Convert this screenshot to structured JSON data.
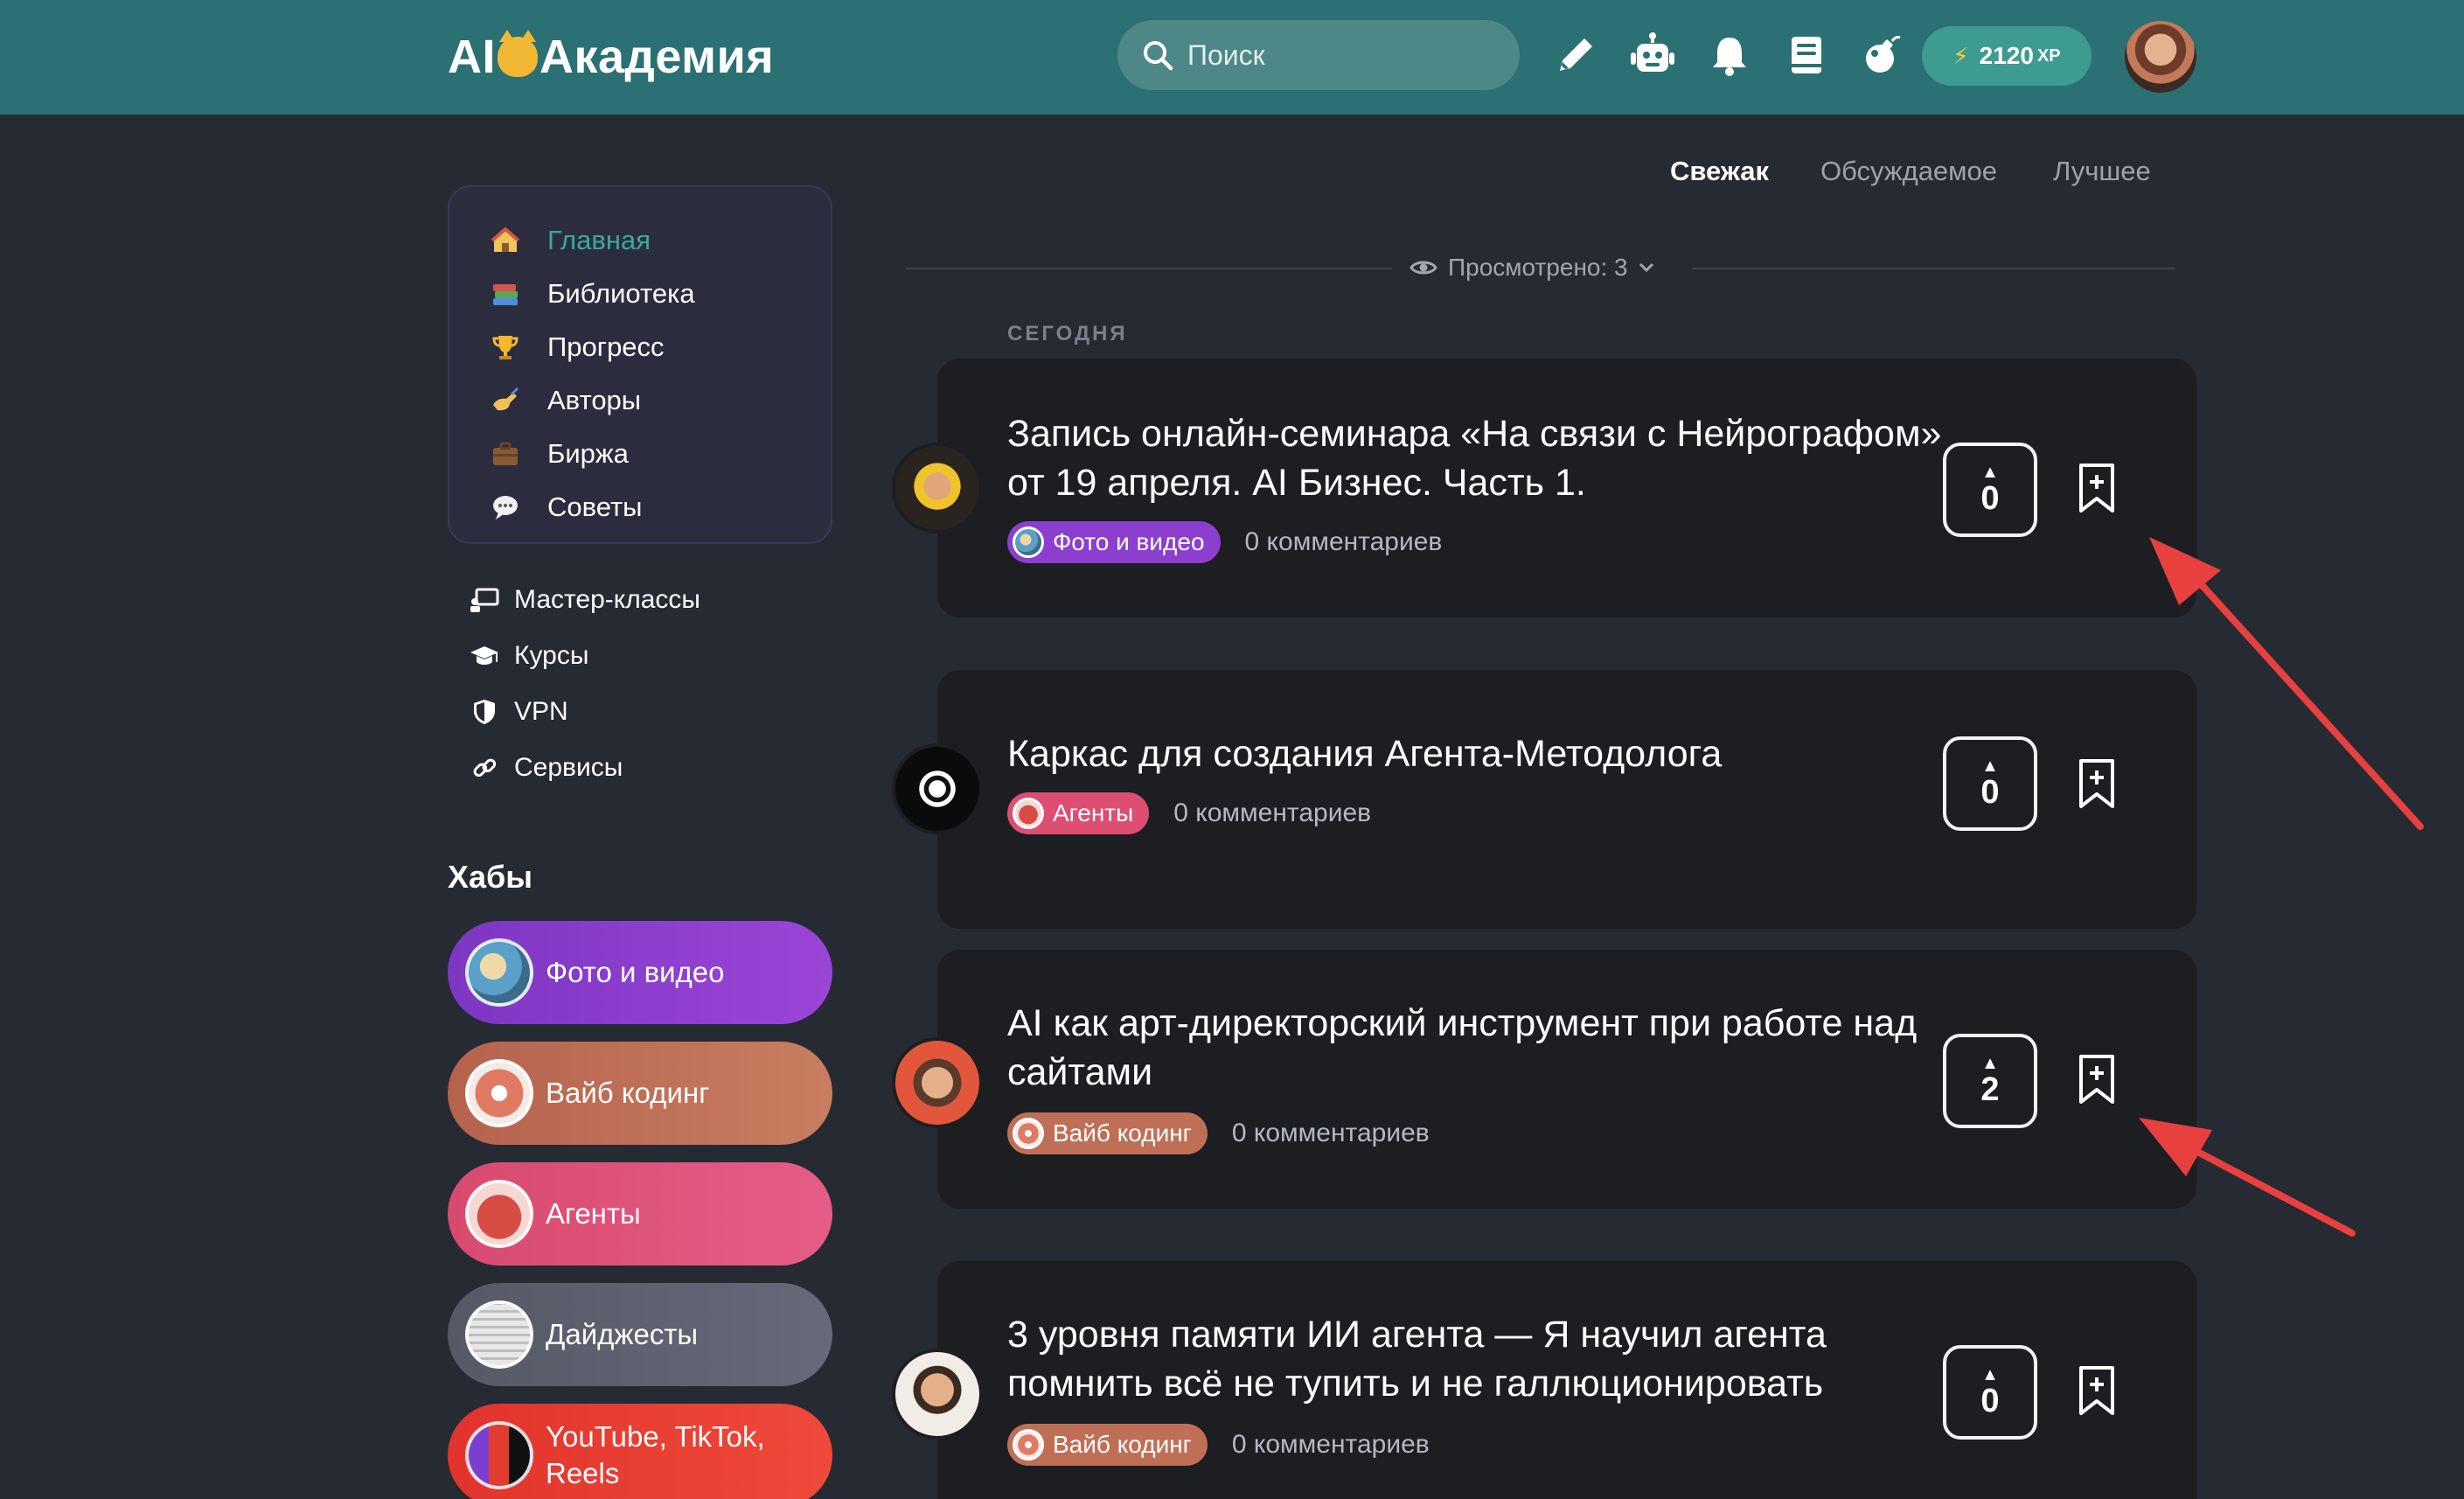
{
  "header": {
    "logo": {
      "prefix": "AI",
      "suffix": "Академия"
    },
    "search_placeholder": "Поиск",
    "xp_value": "2120",
    "xp_label": "XP",
    "icons": [
      "pencil-icon",
      "robot-icon",
      "bell-icon",
      "book-icon",
      "bomb-icon"
    ]
  },
  "sidebar": {
    "nav": [
      {
        "label": "Главная",
        "icon": "house-icon",
        "active": true
      },
      {
        "label": "Библиотека",
        "icon": "books-icon"
      },
      {
        "label": "Прогресс",
        "icon": "trophy-icon"
      },
      {
        "label": "Авторы",
        "icon": "writing-hand-icon"
      },
      {
        "label": "Биржа",
        "icon": "briefcase-icon"
      },
      {
        "label": "Советы",
        "icon": "speech-bubble-icon"
      }
    ],
    "links": [
      {
        "label": "Мастер-классы",
        "icon": "presentation-icon"
      },
      {
        "label": "Курсы",
        "icon": "graduation-cap-icon"
      },
      {
        "label": "VPN",
        "icon": "shield-icon"
      },
      {
        "label": "Сервисы",
        "icon": "link-icon"
      }
    ],
    "hubs_title": "Хабы",
    "hubs": [
      {
        "label": "Фото и видео",
        "color": "#8e3ed0"
      },
      {
        "label": "Вайб кодинг",
        "color": "#bb6d55"
      },
      {
        "label": "Агенты",
        "color": "#dd5178"
      },
      {
        "label": "Дайджесты",
        "color": "#5b5e6b"
      },
      {
        "label": "YouTube, TikTok, Reels",
        "color": "#e6392f"
      }
    ]
  },
  "feed": {
    "tabs": [
      {
        "label": "Свежак",
        "active": true
      },
      {
        "label": "Обсуждаемое",
        "active": false
      },
      {
        "label": "Лучшее",
        "active": false
      }
    ],
    "viewed": "Просмотрено: 3",
    "day_label": "СЕГОДНЯ",
    "posts": [
      {
        "title": "Запись онлайн-семинара «На связи с Нейрографом» от 19 апреля. AI Бизнес. Часть 1.",
        "tag": "Фото и видео",
        "comments": "0 комментариев",
        "votes": "0"
      },
      {
        "title": "Каркас для создания Агента-Методолога",
        "tag": "Агенты",
        "comments": "0 комментариев",
        "votes": "0"
      },
      {
        "title": "AI как арт-директорский инструмент при работе над сайтами",
        "tag": "Вайб кодинг",
        "comments": "0 комментариев",
        "votes": "2"
      },
      {
        "title": "3 уровня памяти ИИ агента — Я научил агента помнить всё не тупить и не галлюционировать",
        "tag": "Вайб кодинг",
        "comments": "0 комментариев",
        "votes": "0"
      }
    ]
  },
  "colors": {
    "header_bg": "#2b7072",
    "page_bg": "#262a33",
    "card_bg": "#1d1e22",
    "accent": "#3aa99a",
    "arrow": "#e8403e"
  }
}
